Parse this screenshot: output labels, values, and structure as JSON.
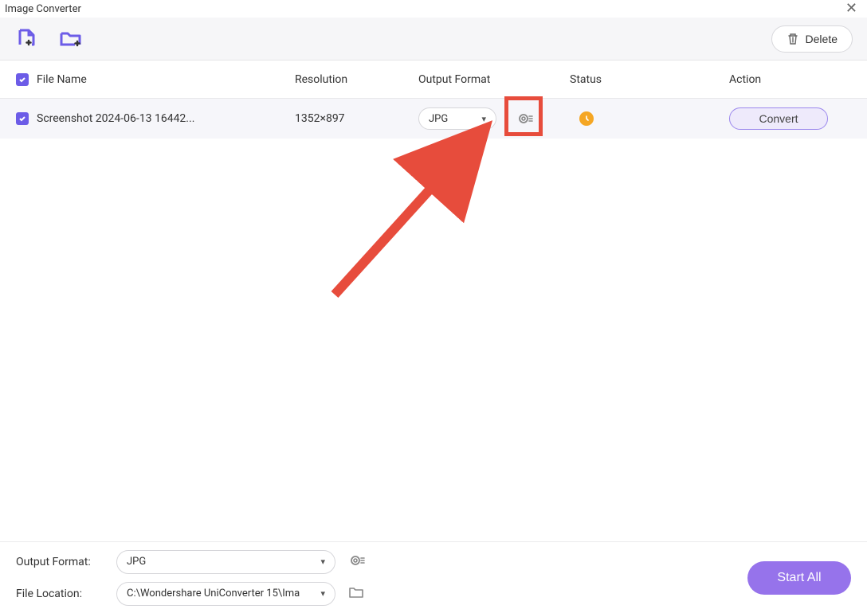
{
  "window": {
    "title": "Image Converter"
  },
  "toolbar": {
    "delete_label": "Delete"
  },
  "columns": {
    "filename": "File Name",
    "resolution": "Resolution",
    "output_format": "Output Format",
    "status": "Status",
    "action": "Action"
  },
  "rows": [
    {
      "filename": "Screenshot 2024-06-13 16442...",
      "resolution": "1352×897",
      "format": "JPG",
      "convert_label": "Convert"
    }
  ],
  "bottom": {
    "output_format_label": "Output Format:",
    "output_format_value": "JPG",
    "file_location_label": "File Location:",
    "file_location_value": "C:\\Wondershare UniConverter 15\\Ima",
    "start_all_label": "Start All"
  }
}
